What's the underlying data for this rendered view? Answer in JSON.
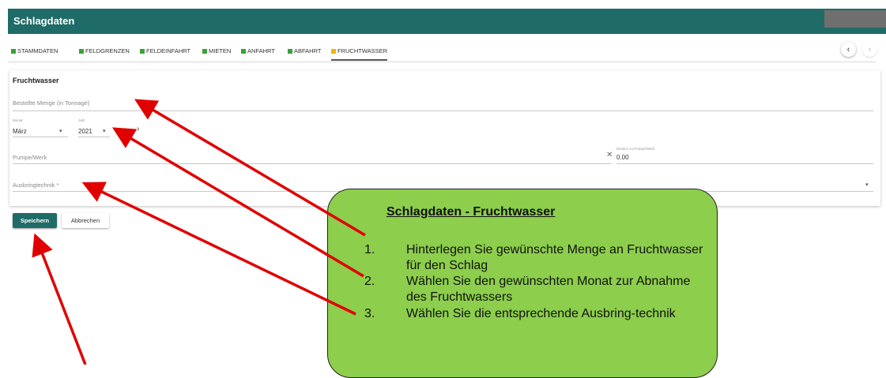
{
  "app": {
    "title": "Schlagdaten"
  },
  "tabs": [
    {
      "label": "STAMMDATEN",
      "active": false
    },
    {
      "label": "FELDGRENZEN",
      "active": false
    },
    {
      "label": "FELDEINFAHRT",
      "active": false
    },
    {
      "label": "MIETEN",
      "active": false
    },
    {
      "label": "ANFAHRT",
      "active": false
    },
    {
      "label": "ABFAHRT",
      "active": false
    },
    {
      "label": "FRUCHTWASSER",
      "active": true
    }
  ],
  "nav": {
    "prev_icon": "‹",
    "next_icon": "›"
  },
  "form": {
    "title": "Fruchtwasser",
    "bestellte_menge_label": "Bestellte Menge (in Tonnage)",
    "monat_label": "Monat",
    "monat_value": "März",
    "jahr_label": "Jahr",
    "jahr_value": "2021",
    "step_forward": "›",
    "pumpe_label": "Pumpe/Werk",
    "clear_icon": "✕",
    "distanz_label": "Distanz zu Pumpe/Werk",
    "distanz_value": "0.00",
    "ausbring_label": "Ausbringtechnik *"
  },
  "buttons": {
    "save": "Speichern",
    "cancel": "Abbrechen"
  },
  "callout": {
    "heading": "Schlagdaten - Fruchtwasser",
    "items": [
      {
        "num": "1.",
        "text": "Hinterlegen Sie gewünschte Menge an Fruchtwasser für den Schlag"
      },
      {
        "num": "2.",
        "text": "Wählen Sie den gewünschten Monat zur Abnahme des Fruchtwassers"
      },
      {
        "num": "3.",
        "text": "Wählen Sie die entsprechende Ausbring-technik"
      }
    ]
  },
  "colors": {
    "primary": "#1f6b67",
    "tab_green": "#3aa03a",
    "tab_active": "#f4b400",
    "callout": "#8dce4c",
    "arrow": "#e00000"
  }
}
